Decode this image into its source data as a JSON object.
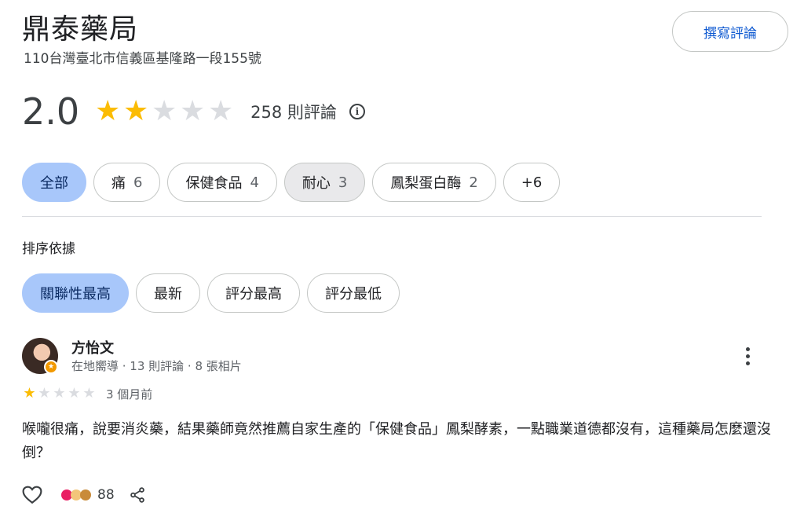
{
  "place": {
    "name": "鼎泰藥局",
    "address": "110台灣臺北市信義區基隆路一段155號"
  },
  "write_review": {
    "label": "撰寫評論"
  },
  "rating": {
    "value": "2.0",
    "stars": 2,
    "max_stars": 5,
    "review_count_label": "258 則評論",
    "info_icon": "info-icon"
  },
  "topic_chips": [
    {
      "label": "全部",
      "count": "",
      "active": true
    },
    {
      "label": "痛",
      "count": "6",
      "active": false
    },
    {
      "label": "保健食品",
      "count": "4",
      "active": false
    },
    {
      "label": "耐心",
      "count": "3",
      "active": false
    },
    {
      "label": "鳳梨蛋白酶",
      "count": "2",
      "active": false
    },
    {
      "label": "+6",
      "count": "",
      "active": false
    }
  ],
  "sort": {
    "label": "排序依據",
    "options": [
      "關聯性最高",
      "最新",
      "評分最高",
      "評分最低"
    ],
    "selected": "關聯性最高"
  },
  "review": {
    "reviewer_name": "方怡文",
    "reviewer_meta": "在地嚮導 · 13 則評論 · 8 張相片",
    "stars": 1,
    "max_stars": 5,
    "date": "3 個月前",
    "text": "喉嚨很痛，說要消炎藥，結果藥師竟然推薦自家生產的「保健食品」鳳梨酵素，一點職業道德都沒有，這種藥局怎麼還沒倒？",
    "reaction_count": "88",
    "icons": [
      "heart-outline-icon",
      "heart-reaction-icon",
      "face-reaction-icon",
      "pray-reaction-icon",
      "share-icon",
      "more-vert-icon"
    ]
  },
  "colors": {
    "star_filled": "#fbbc04",
    "star_empty": "#dadce0",
    "chip_active_bg": "#a8c7fa",
    "link_blue": "#0b57d0"
  }
}
